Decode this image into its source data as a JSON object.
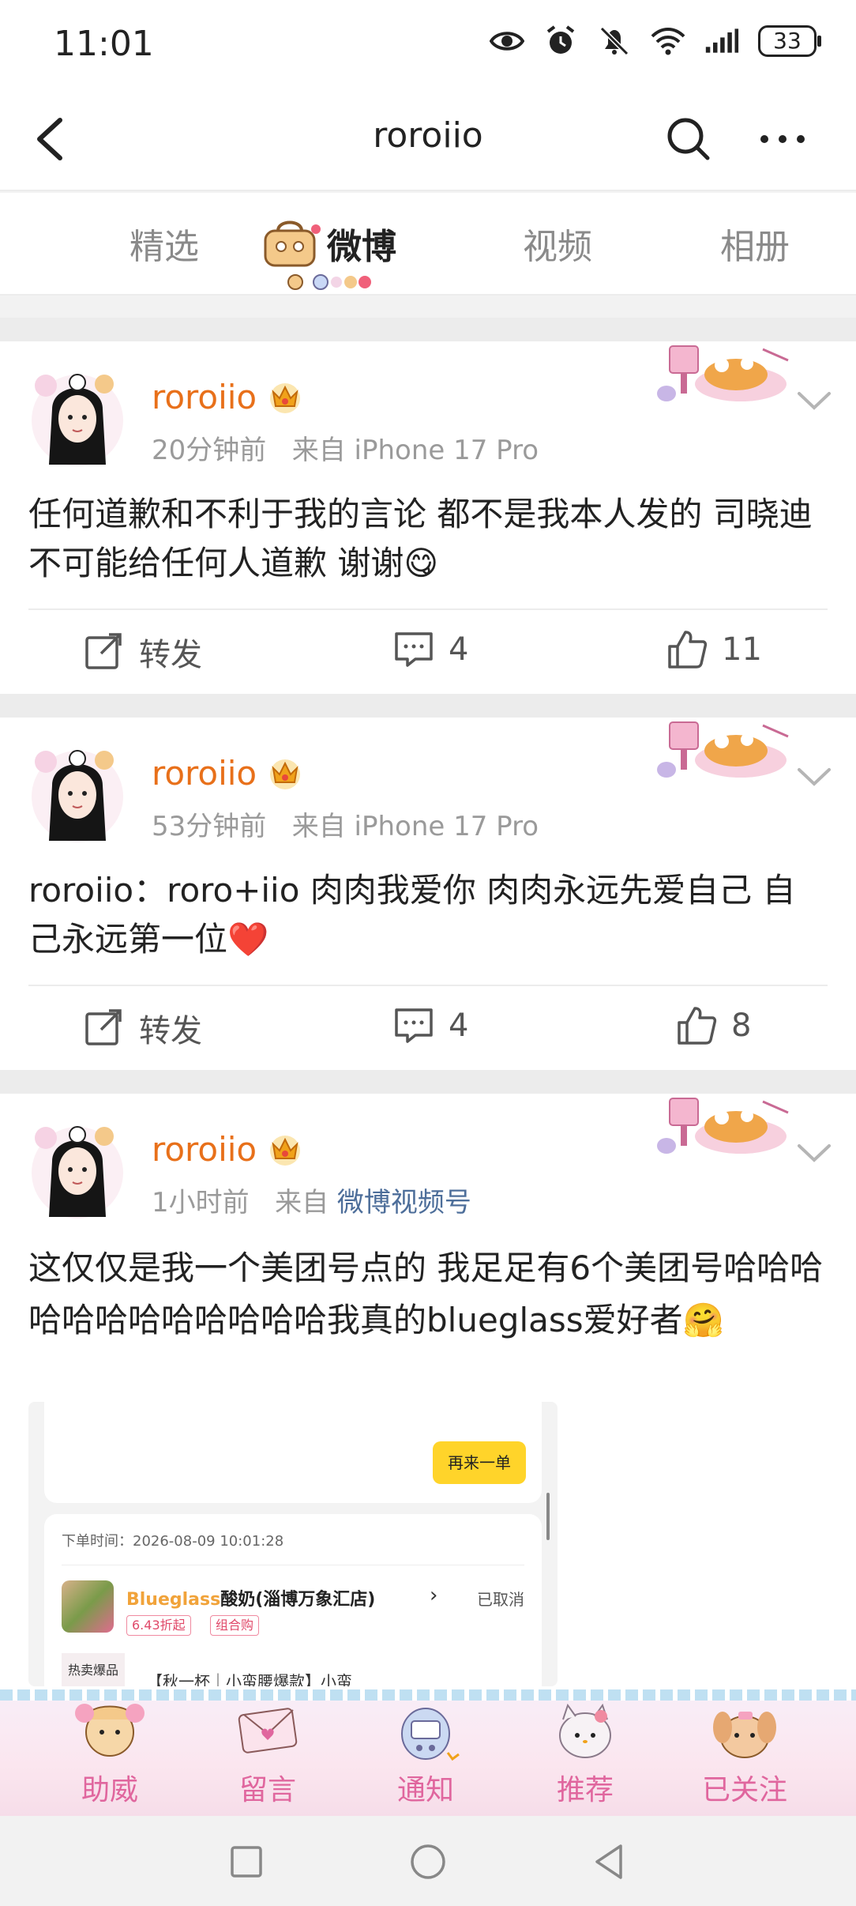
{
  "status_bar": {
    "time": "11:01",
    "battery": "33",
    "icons": [
      "eye-icon",
      "alarm-icon",
      "mute-icon",
      "wifi-icon",
      "signal-icon"
    ]
  },
  "header": {
    "title": "roroiio"
  },
  "tabs": [
    {
      "label": "精选",
      "active": false
    },
    {
      "label": "微博",
      "active": true
    },
    {
      "label": "视频",
      "active": false
    },
    {
      "label": "相册",
      "active": false
    }
  ],
  "posts": [
    {
      "username": "roroiio",
      "time": "20分钟前",
      "source_prefix": "来自",
      "source": "iPhone 17 Pro",
      "text": "任何道歉和不利于我的言论 都不是我本人发的 司晓迪不可能给任何人道歉 谢谢😋",
      "repost_label": "转发",
      "comments": "4",
      "likes": "11"
    },
    {
      "username": "roroiio",
      "time": "53分钟前",
      "source_prefix": "来自",
      "source": "iPhone 17 Pro",
      "text": "roroiio：roro+iio 肉肉我爱你 肉肉永远先爱自己 自己永远第一位❤️",
      "repost_label": "转发",
      "comments": "4",
      "likes": "8"
    },
    {
      "username": "roroiio",
      "time": "1小时前",
      "source_prefix": "来自",
      "source": "微博视频号",
      "text": "这仅仅是我一个美团号点的 我足足有6个美团号哈哈哈哈哈哈哈哈哈哈哈哈我真的blueglass爱好者🤗"
    }
  ],
  "embedded_image": {
    "reorder_button": "再来一单",
    "order_time": "下单时间：2026-08-09 10:01:28",
    "shop_brand": "Blueglass",
    "shop_name": "酸奶(淄博万象汇店)",
    "status": "已取消",
    "tag_discount": "6.43折起",
    "tag_combo": "组合购",
    "hot_label": "热卖爆品",
    "promo_text": "【秋一杯｜小蛮腰爆款】小蛮"
  },
  "bottom_nav": [
    {
      "label": "助威",
      "icon": "cheer-icon"
    },
    {
      "label": "留言",
      "icon": "message-icon"
    },
    {
      "label": "通知",
      "icon": "notification-icon"
    },
    {
      "label": "推荐",
      "icon": "recommend-icon"
    },
    {
      "label": "已关注",
      "icon": "following-icon"
    }
  ],
  "colors": {
    "username": "#e8701a",
    "source_link": "#4d6e9a",
    "bottom_label": "#e0669e",
    "accent_yellow": "#ffd42a"
  }
}
